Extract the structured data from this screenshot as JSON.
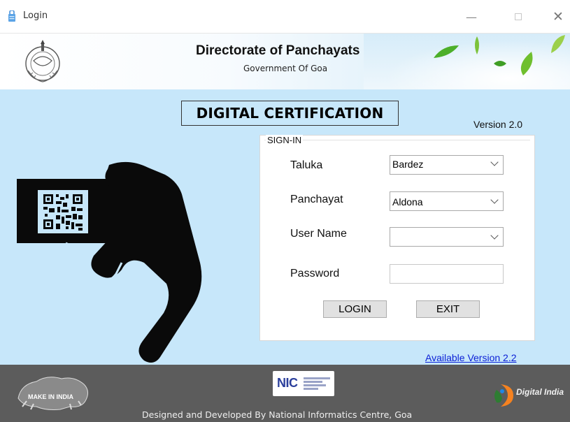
{
  "window": {
    "title": "Login",
    "controls": {
      "minimize": "—",
      "close": "✕"
    }
  },
  "header": {
    "org_title": "Directorate of Panchayats",
    "org_subtitle": "Government Of Goa"
  },
  "main": {
    "app_heading": "DIGITAL CERTIFICATION",
    "version_label": "Version 2.0",
    "available_version_link": "Available Version 2.2"
  },
  "signin": {
    "legend": "SIGN-IN",
    "fields": {
      "taluka": {
        "label": "Taluka",
        "value": "Bardez"
      },
      "panchayat": {
        "label": "Panchayat",
        "value": "Aldona"
      },
      "username": {
        "label": "User Name",
        "value": ""
      },
      "password": {
        "label": "Password",
        "value": ""
      }
    },
    "buttons": {
      "login": "LOGIN",
      "exit": "EXIT"
    }
  },
  "footer": {
    "credit": "Designed and Developed By National Informatics Centre, Goa",
    "logos": {
      "make_in_india": "MAKE IN INDIA",
      "nic": "NIC",
      "digital_india": "Digital India"
    }
  },
  "colors": {
    "panel_bg": "#c7e7fa",
    "footer_bg": "#5c5c5c",
    "link": "#0a1fd6"
  },
  "icons": [
    "app-lock-icon",
    "state-emblem-icon",
    "qr-hand-illustration",
    "combo-chevron-icon"
  ]
}
